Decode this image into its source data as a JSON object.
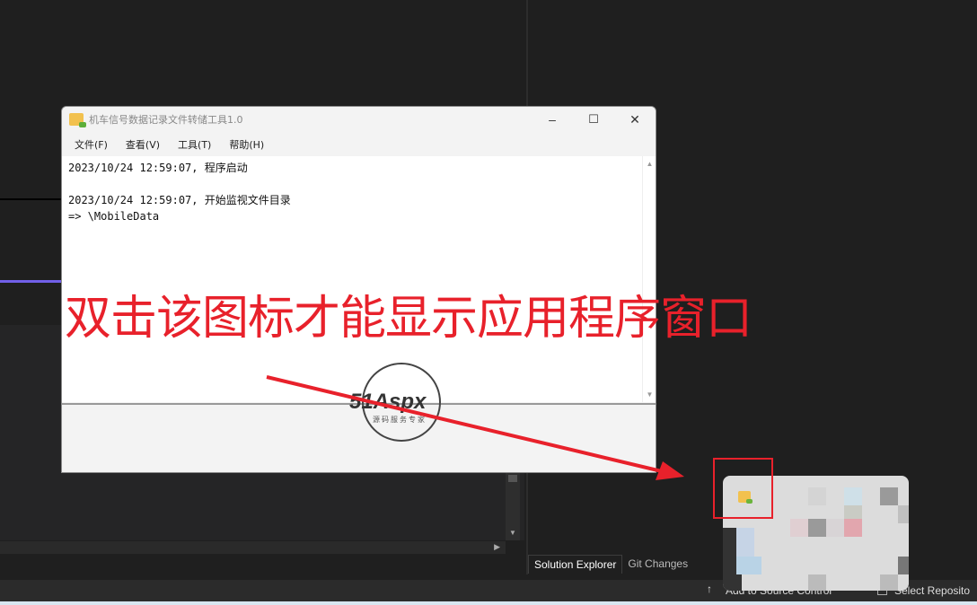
{
  "window": {
    "title": "机车信号数据记录文件转储工具1.0",
    "minimize": "–",
    "maximize": "☐",
    "close": "✕"
  },
  "menu": [
    "文件(F)",
    "查看(V)",
    "工具(T)",
    "帮助(H)"
  ],
  "log": "2023/10/24 12:59:07, 程序启动\n\n2023/10/24 12:59:07, 开始监视文件目录\n=> \\MobileData",
  "annotation": {
    "text": "双击该图标才能显示应用程序窗口",
    "color": "#e8212b"
  },
  "watermark": {
    "brand": "51Aspx",
    "tagline": "源码服务专家"
  },
  "ide": {
    "tabs": [
      "Solution Explorer",
      "Git Changes"
    ],
    "status": {
      "add_source": "Add to Source Control",
      "select_repo": "Select Reposito"
    }
  }
}
